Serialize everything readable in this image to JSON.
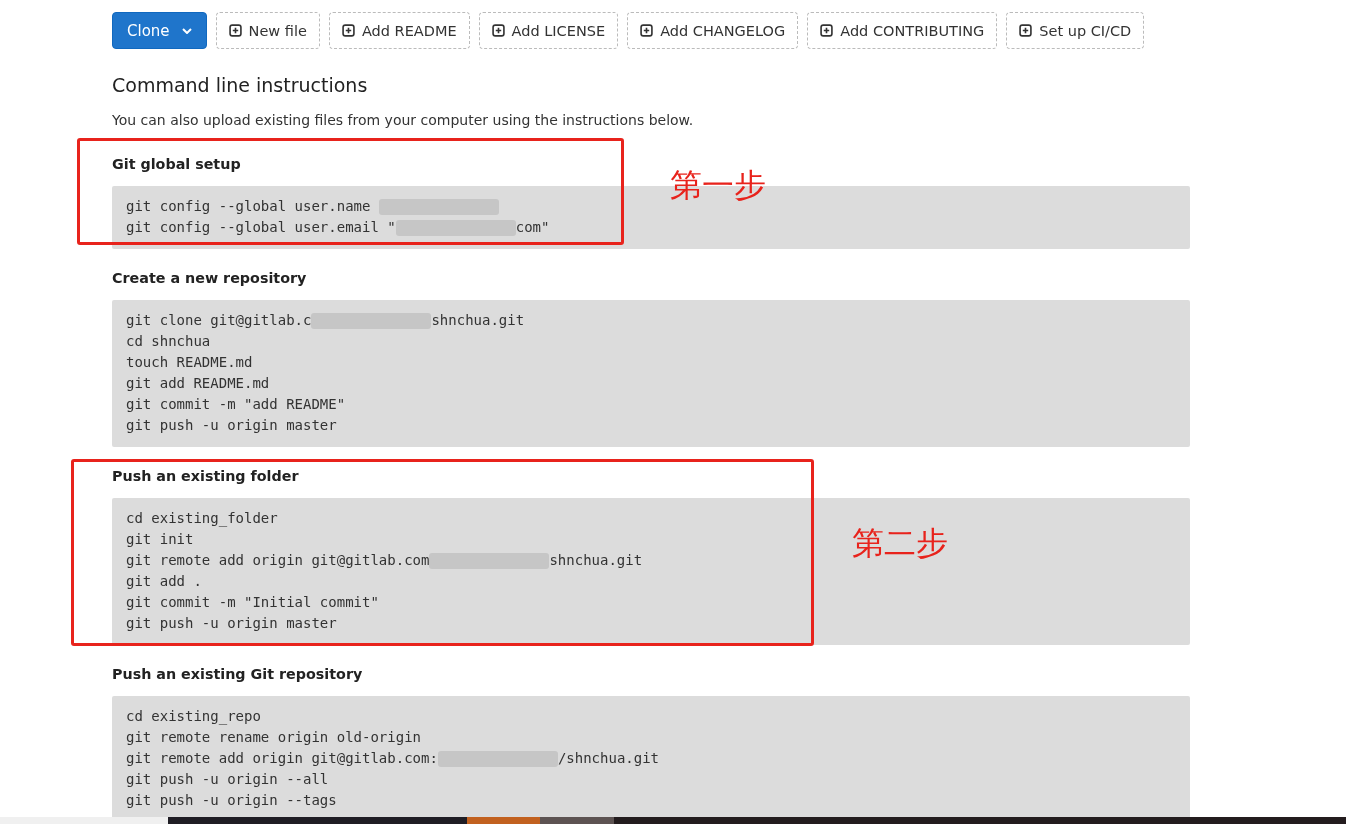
{
  "toolbar": {
    "clone_button": {
      "label": "Clone"
    },
    "buttons": [
      {
        "label": "New file"
      },
      {
        "label": "Add README"
      },
      {
        "label": "Add LICENSE"
      },
      {
        "label": "Add CHANGELOG"
      },
      {
        "label": "Add CONTRIBUTING"
      },
      {
        "label": "Set up CI/CD"
      }
    ]
  },
  "title": "Command line instructions",
  "intro": "You can also upload existing files from your computer using the instructions below.",
  "sections": [
    {
      "heading": "Git global setup",
      "annotation": "第一步",
      "lines": [
        [
          {
            "kind": "text",
            "text": "git config --global user.name "
          },
          {
            "kind": "redacted"
          }
        ],
        [
          {
            "kind": "text",
            "text": "git config --global user.email \""
          },
          {
            "kind": "redacted"
          },
          {
            "kind": "text",
            "text": "com\""
          }
        ]
      ]
    },
    {
      "heading": "Create a new repository",
      "lines": [
        [
          {
            "kind": "text",
            "text": "git clone git@gitlab.c"
          },
          {
            "kind": "redacted"
          },
          {
            "kind": "text",
            "text": "shnchua.git"
          }
        ],
        [
          {
            "kind": "text",
            "text": "cd shnchua"
          }
        ],
        [
          {
            "kind": "text",
            "text": "touch README.md"
          }
        ],
        [
          {
            "kind": "text",
            "text": "git add README.md"
          }
        ],
        [
          {
            "kind": "text",
            "text": "git commit -m \"add README\""
          }
        ],
        [
          {
            "kind": "text",
            "text": "git push -u origin master"
          }
        ]
      ]
    },
    {
      "heading": "Push an existing folder",
      "annotation": "第二步",
      "lines": [
        [
          {
            "kind": "text",
            "text": "cd existing_folder"
          }
        ],
        [
          {
            "kind": "text",
            "text": "git init"
          }
        ],
        [
          {
            "kind": "text",
            "text": "git remote add origin git@gitlab.com"
          },
          {
            "kind": "redacted"
          },
          {
            "kind": "text",
            "text": "shnchua.git"
          }
        ],
        [
          {
            "kind": "text",
            "text": "git add ."
          }
        ],
        [
          {
            "kind": "text",
            "text": "git commit -m \"Initial commit\""
          }
        ],
        [
          {
            "kind": "text",
            "text": "git push -u origin master"
          }
        ]
      ]
    },
    {
      "heading": "Push an existing Git repository",
      "lines": [
        [
          {
            "kind": "text",
            "text": "cd existing_repo"
          }
        ],
        [
          {
            "kind": "text",
            "text": "git remote rename origin old-origin"
          }
        ],
        [
          {
            "kind": "text",
            "text": "git remote add origin git@gitlab.com:"
          },
          {
            "kind": "redacted"
          },
          {
            "kind": "text",
            "text": "/shnchua.git"
          }
        ],
        [
          {
            "kind": "text",
            "text": "git push -u origin --all"
          }
        ],
        [
          {
            "kind": "text",
            "text": "git push -u origin --tags"
          }
        ]
      ]
    }
  ]
}
